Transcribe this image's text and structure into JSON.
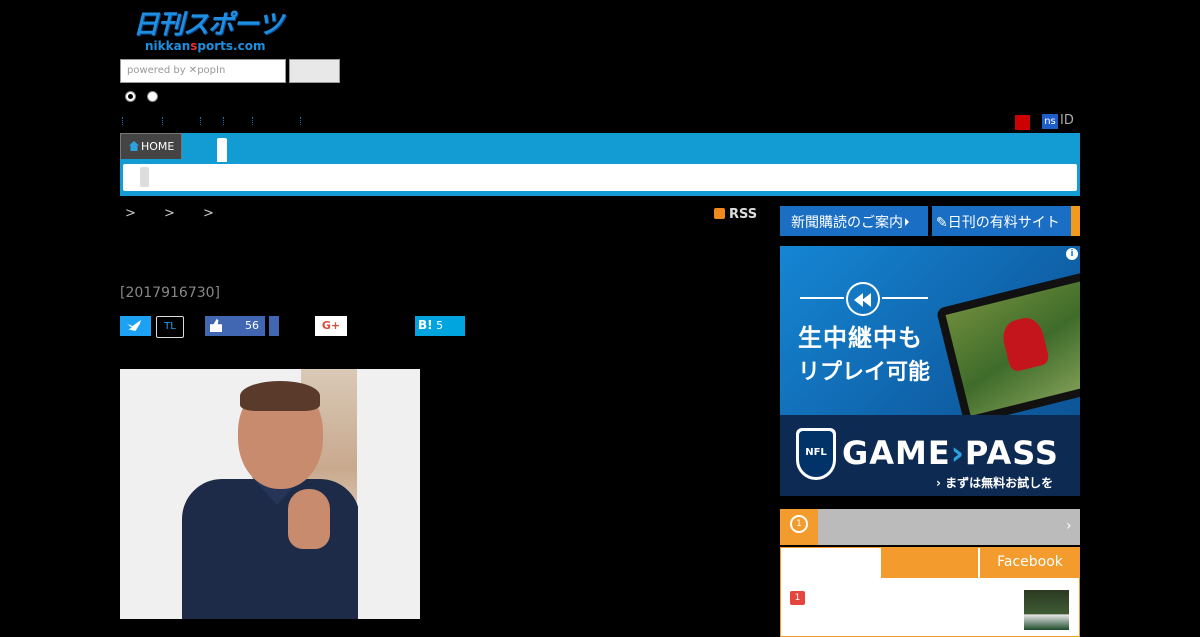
{
  "header": {
    "logo_jp": "日刊スポーツ",
    "logo_en_pre": "nikkan",
    "logo_en_red": "s",
    "logo_en_post": "ports.com",
    "search_placeholder": "powered by ✕popIn",
    "id_label": "ID",
    "ns_badge": "ns"
  },
  "nav": {
    "home_label": "HOME"
  },
  "breadcrumb": {
    "separators": "> > >",
    "rss_label": "RSS"
  },
  "article": {
    "dateline": "[2017916730]"
  },
  "social": {
    "tl_label": "TL",
    "fb_count": "56",
    "gplus_label": "G+",
    "hatena_label": "B!",
    "hatena_count": "5"
  },
  "sidebar": {
    "subscription_button": "新聞購読のご案内",
    "paid_site_button": "日刊の有料サイト",
    "ad": {
      "headline1": "生中継中も",
      "headline2": "リプレイ可能",
      "nfl_label": "NFL",
      "brand_a": "GAME",
      "brand_b": "PASS",
      "cta": "まずは無料お試しを",
      "info": "i"
    },
    "ranking": {
      "arrow": "›",
      "medal": "1",
      "tab_facebook": "Facebook",
      "first_rank": "1"
    }
  },
  "colors": {
    "nav_blue": "#139bd4",
    "button_blue": "#1a6fc4",
    "accent_orange": "#f39b2c"
  }
}
